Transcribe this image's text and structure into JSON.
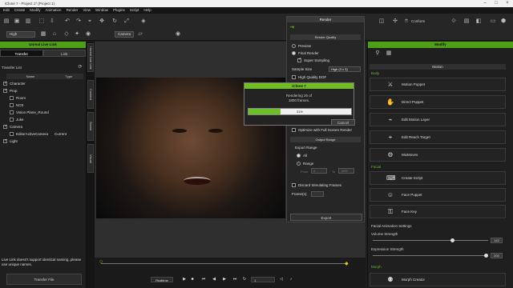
{
  "window": {
    "title": "iClone 7 - Project 1* (Project 1)"
  },
  "menu": [
    "Edit",
    "Create",
    "Modify",
    "Animation",
    "Render",
    "View",
    "Window",
    "Plugins",
    "Script",
    "Help"
  ],
  "toolbar": {
    "quality": "High",
    "camera": "Camera",
    "conform": "Conform"
  },
  "left": {
    "panel_title": "Unreal Live Link",
    "tabs": [
      "Transfer",
      "Link"
    ],
    "list_title": "Transfer List",
    "columns": [
      "Name",
      "Type"
    ],
    "rows": [
      {
        "name": "Character",
        "checked": true,
        "indent": 0
      },
      {
        "name": "Prop",
        "checked": true,
        "indent": 0
      },
      {
        "name": "Room",
        "checked": false,
        "indent": 1
      },
      {
        "name": "NO3",
        "checked": false,
        "indent": 1
      },
      {
        "name": "Vision Plane_Round",
        "checked": false,
        "indent": 1
      },
      {
        "name": "Juke",
        "checked": false,
        "indent": 1
      },
      {
        "name": "Camera",
        "checked": true,
        "indent": 0
      },
      {
        "name": "EditorActiveCamera",
        "checked": false,
        "indent": 1,
        "type": "Current"
      },
      {
        "name": "Light",
        "checked": true,
        "indent": 0
      }
    ],
    "note": "Live Link doesn't support identical naming, please use unique names.",
    "transfer_button": "Transfer File"
  },
  "side_tabs": [
    "Unreal Live Link",
    "Content",
    "Scene",
    "Visual"
  ],
  "render": {
    "title": "Render",
    "quality_section": "Render Quality",
    "preview": "Preview",
    "final_render": "Final Render",
    "super_sampling": "Super Sampling",
    "sample_size_label": "Sample Size",
    "sample_size_value": "High (3 x 3)",
    "high_quality_dof": "High Quality DOF",
    "optimize": "Optimize with Full Screen Render",
    "output_range": "Output Range",
    "export_range": "Export Range",
    "all": "All",
    "range": "Range",
    "from_label": "From",
    "from_value": "0",
    "to_label": "To",
    "to_value": "1800",
    "discard": "Discard Simulating Frames",
    "frames_label": "Frame(s):",
    "export_button": "Export"
  },
  "progress": {
    "title": "iClone 7",
    "message1": "Rendering 26 of",
    "message2": "1800 frames.",
    "percent": "31%",
    "cancel": "Cancel",
    "level": 0.31
  },
  "timeline": {
    "realtime": "Realtime",
    "frame": "1"
  },
  "modify": {
    "title": "Modify",
    "motion": "Motion",
    "body": "Body",
    "body_tools": [
      "Motion Puppet",
      "Direct Puppet",
      "Edit Motion Layer",
      "Edit Reach Target",
      "MixMoves"
    ],
    "facial": "Facial",
    "facial_tools": [
      "Create Script",
      "Face Puppet",
      "Face Key"
    ],
    "facial_settings": "Facial Animation Settings",
    "volume_label": "Volume Strength",
    "volume_value": "142",
    "volume_level": 0.7,
    "expression_label": "Expression Strength",
    "expression_value": "200",
    "expression_level": 1,
    "morph": "Morph",
    "morph_creator": "Morph Creator"
  }
}
